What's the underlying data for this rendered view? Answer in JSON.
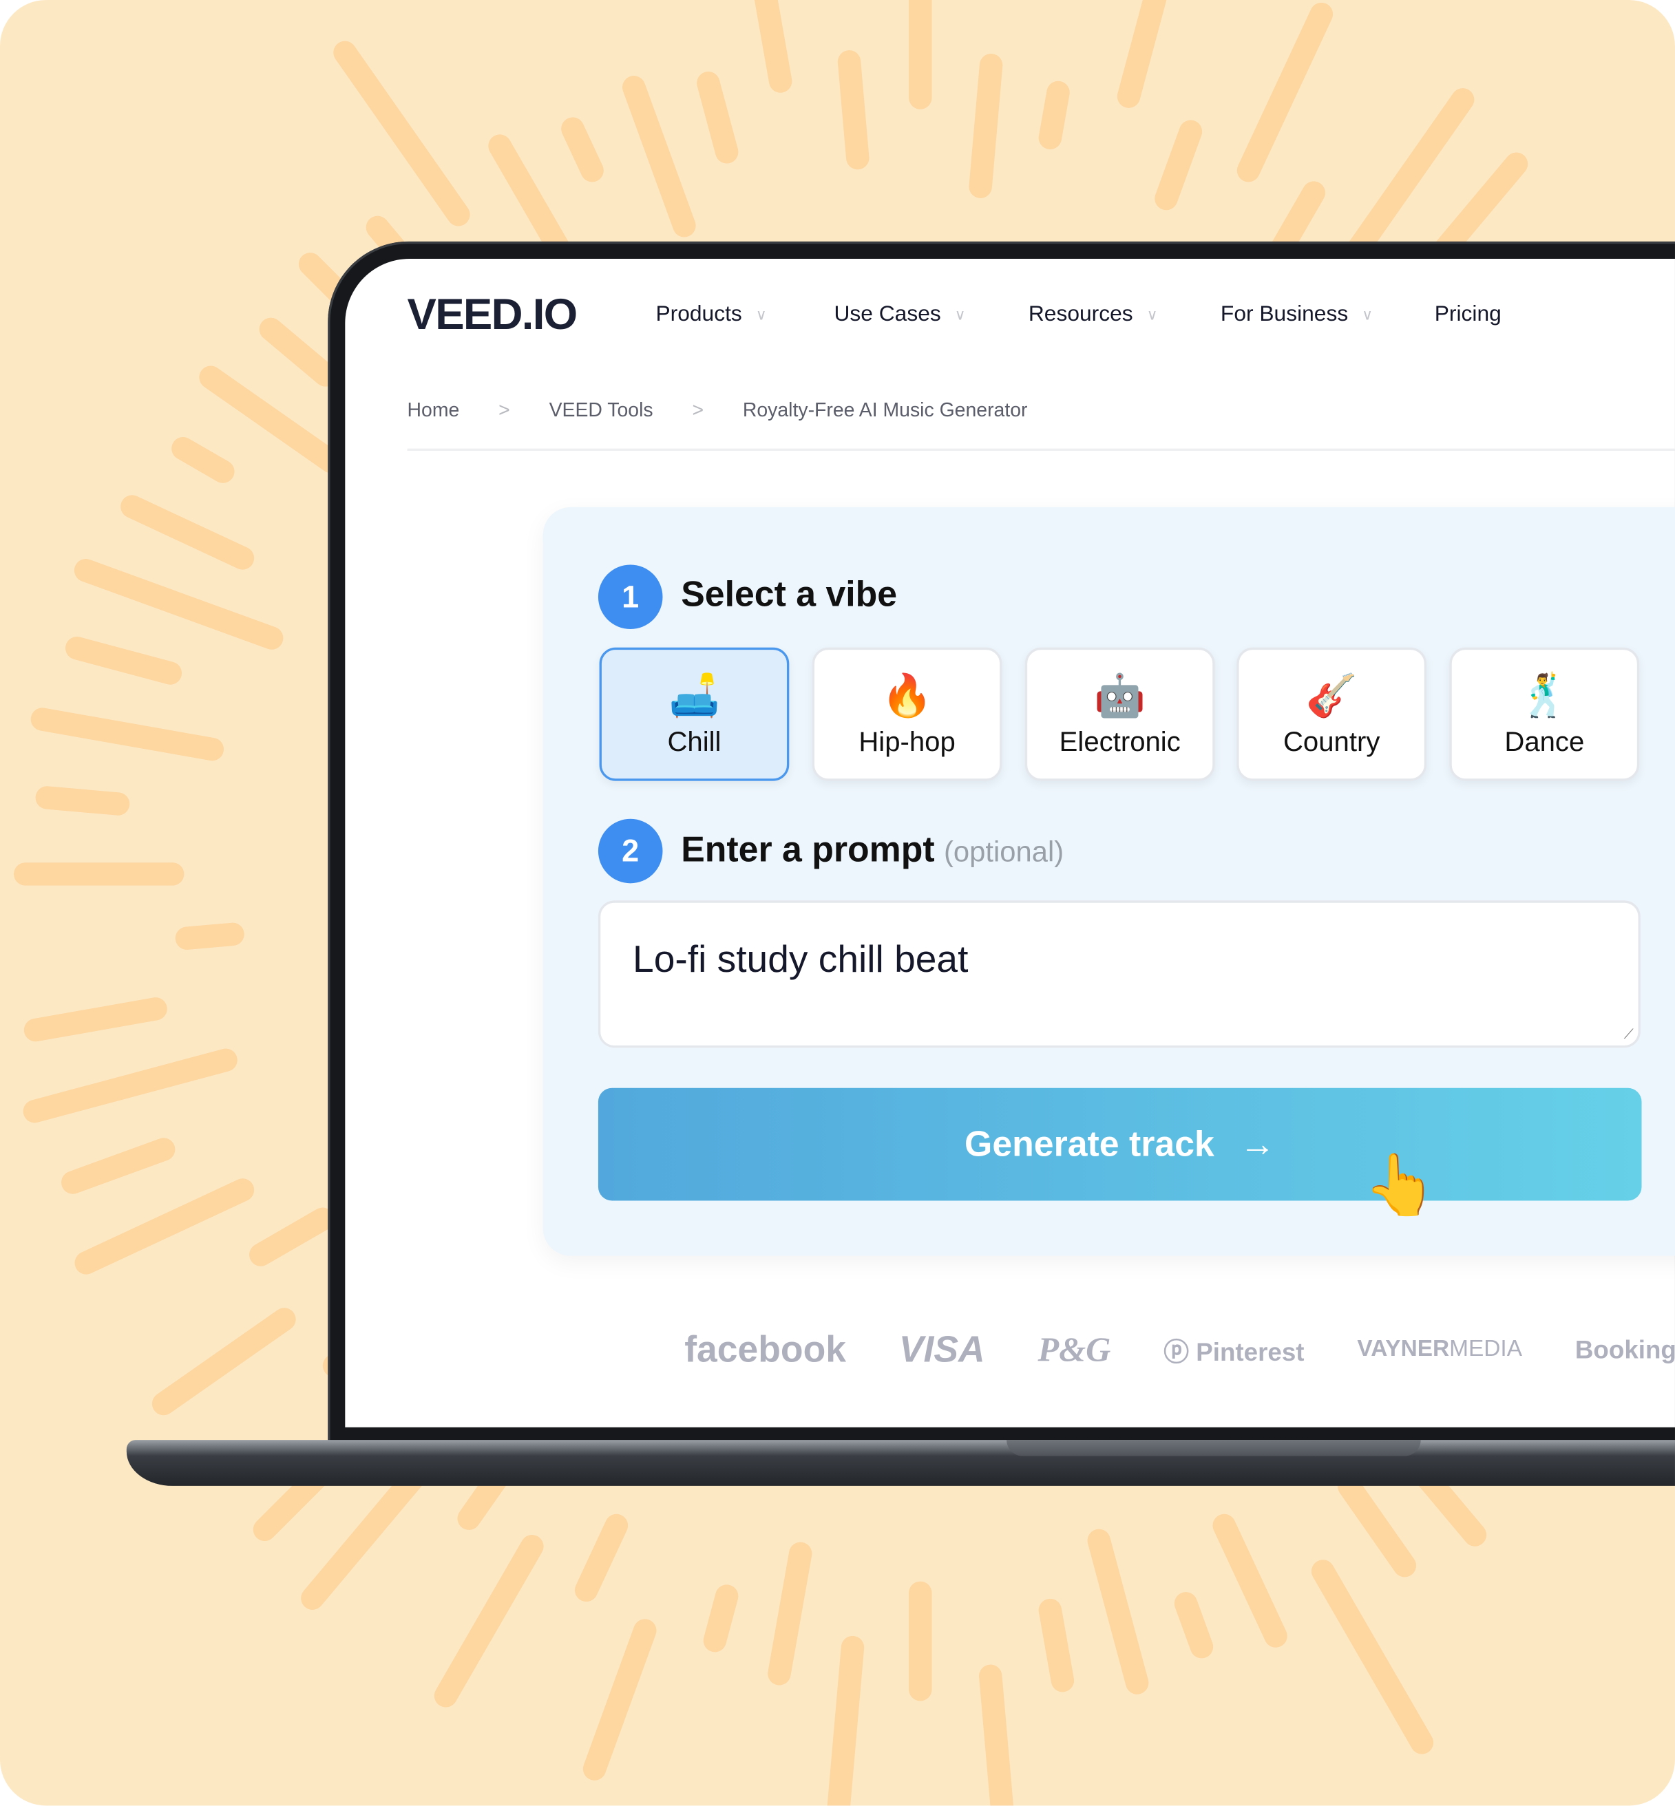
{
  "brand": {
    "logo": "VEED.IO",
    "accent": "#3d8ef0"
  },
  "nav": [
    {
      "label": "Products",
      "dropdown": true
    },
    {
      "label": "Use Cases",
      "dropdown": true
    },
    {
      "label": "Resources",
      "dropdown": true
    },
    {
      "label": "For Business",
      "dropdown": true
    },
    {
      "label": "Pricing",
      "dropdown": false
    }
  ],
  "breadcrumb": {
    "items": [
      "Home",
      "VEED Tools",
      "Royalty-Free AI Music Generator"
    ],
    "separator": ">"
  },
  "step1": {
    "number": "1",
    "title": "Select a vibe"
  },
  "vibes": [
    {
      "emoji": "🛋️",
      "label": "Chill",
      "selected": true
    },
    {
      "emoji": "🔥",
      "label": "Hip-hop",
      "selected": false
    },
    {
      "emoji": "🤖",
      "label": "Electronic",
      "selected": false
    },
    {
      "emoji": "🎸",
      "label": "Country",
      "selected": false
    },
    {
      "emoji": "🕺",
      "label": "Dance",
      "selected": false
    }
  ],
  "step2": {
    "number": "2",
    "title": "Enter a prompt",
    "optional": "(optional)"
  },
  "prompt": {
    "value": "Lo-fi study chill beat"
  },
  "generate": {
    "label": "Generate track",
    "arrow": "→"
  },
  "cursor": {
    "icon": "hand-pointer-icon",
    "glyph": "👆"
  },
  "client_logos": [
    "facebook",
    "VISA",
    "P&G",
    "Pinterest",
    "VAYNER",
    "MEDIA",
    "Booking.co"
  ]
}
